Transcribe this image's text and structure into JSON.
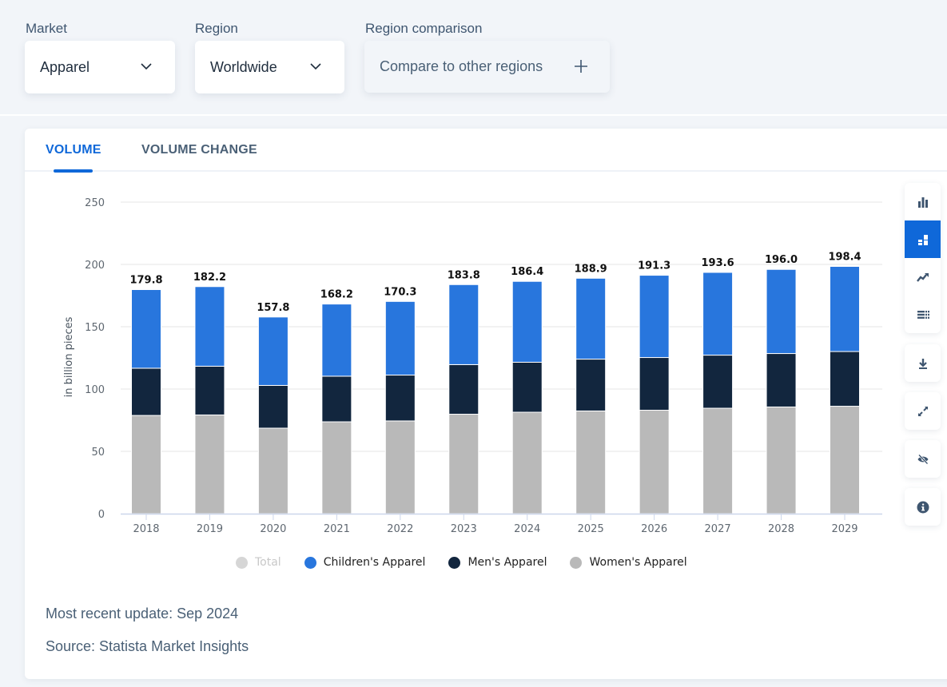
{
  "filters": {
    "market": {
      "label": "Market",
      "value": "Apparel"
    },
    "region": {
      "label": "Region",
      "value": "Worldwide"
    },
    "comparison": {
      "label": "Region comparison",
      "button": "Compare to other regions"
    }
  },
  "tabs": [
    {
      "label": "VOLUME",
      "active": true
    },
    {
      "label": "VOLUME CHANGE",
      "active": false
    }
  ],
  "toolbar": {
    "chart_types": [
      {
        "icon": "bar-chart-icon",
        "active": false
      },
      {
        "icon": "stacked-bar-chart-icon",
        "active": true
      },
      {
        "icon": "line-chart-icon",
        "active": false
      },
      {
        "icon": "table-icon",
        "active": false
      }
    ],
    "actions": [
      {
        "icon": "download-icon"
      },
      {
        "icon": "expand-icon"
      },
      {
        "icon": "hide-icon"
      },
      {
        "icon": "info-icon"
      }
    ]
  },
  "colors": {
    "accent": "#0f68d9",
    "children": "#2876dd",
    "men": "#12263e",
    "women": "#b9b9b9",
    "total": "#d6d6d6"
  },
  "chart_data": {
    "type": "bar",
    "stacked": true,
    "title": "",
    "xlabel": "",
    "ylabel": "in billion pieces",
    "ylim": [
      0,
      250
    ],
    "yticks": [
      0,
      50,
      100,
      150,
      200,
      250
    ],
    "grid": true,
    "legend_position": "bottom",
    "categories": [
      "2018",
      "2019",
      "2020",
      "2021",
      "2022",
      "2023",
      "2024",
      "2025",
      "2026",
      "2027",
      "2028",
      "2029"
    ],
    "series": [
      {
        "name": "Women's Apparel",
        "color": "#b9b9b9",
        "values": [
          78.8,
          79.2,
          68.6,
          73.7,
          74.4,
          79.8,
          81.4,
          82.4,
          83.0,
          84.6,
          85.6,
          86.2
        ]
      },
      {
        "name": "Men's Apparel",
        "color": "#12263e",
        "values": [
          37.9,
          39.1,
          34.3,
          36.6,
          36.8,
          39.8,
          40.1,
          41.6,
          42.3,
          42.6,
          42.9,
          43.9
        ]
      },
      {
        "name": "Children's Apparel",
        "color": "#2876dd",
        "values": [
          63.1,
          63.9,
          54.9,
          57.9,
          59.1,
          64.2,
          64.9,
          64.9,
          66.0,
          66.4,
          67.5,
          68.3
        ]
      }
    ],
    "totals": [
      179.8,
      182.2,
      157.8,
      168.2,
      170.3,
      183.8,
      186.4,
      188.9,
      191.3,
      193.6,
      196.0,
      198.4
    ],
    "total_labels": [
      "179.8",
      "182.2",
      "157.8",
      "168.2",
      "170.3",
      "183.8",
      "186.4",
      "188.9",
      "191.3",
      "193.6",
      "196.0",
      "198.4"
    ],
    "legend": [
      {
        "name": "Total",
        "color": "#d6d6d6",
        "hidden": true
      },
      {
        "name": "Children's Apparel",
        "color": "#2876dd",
        "hidden": false
      },
      {
        "name": "Men's Apparel",
        "color": "#12263e",
        "hidden": false
      },
      {
        "name": "Women's Apparel",
        "color": "#b9b9b9",
        "hidden": false
      }
    ]
  },
  "footer": {
    "update": "Most recent update: Sep 2024",
    "source": "Source: Statista Market Insights"
  }
}
